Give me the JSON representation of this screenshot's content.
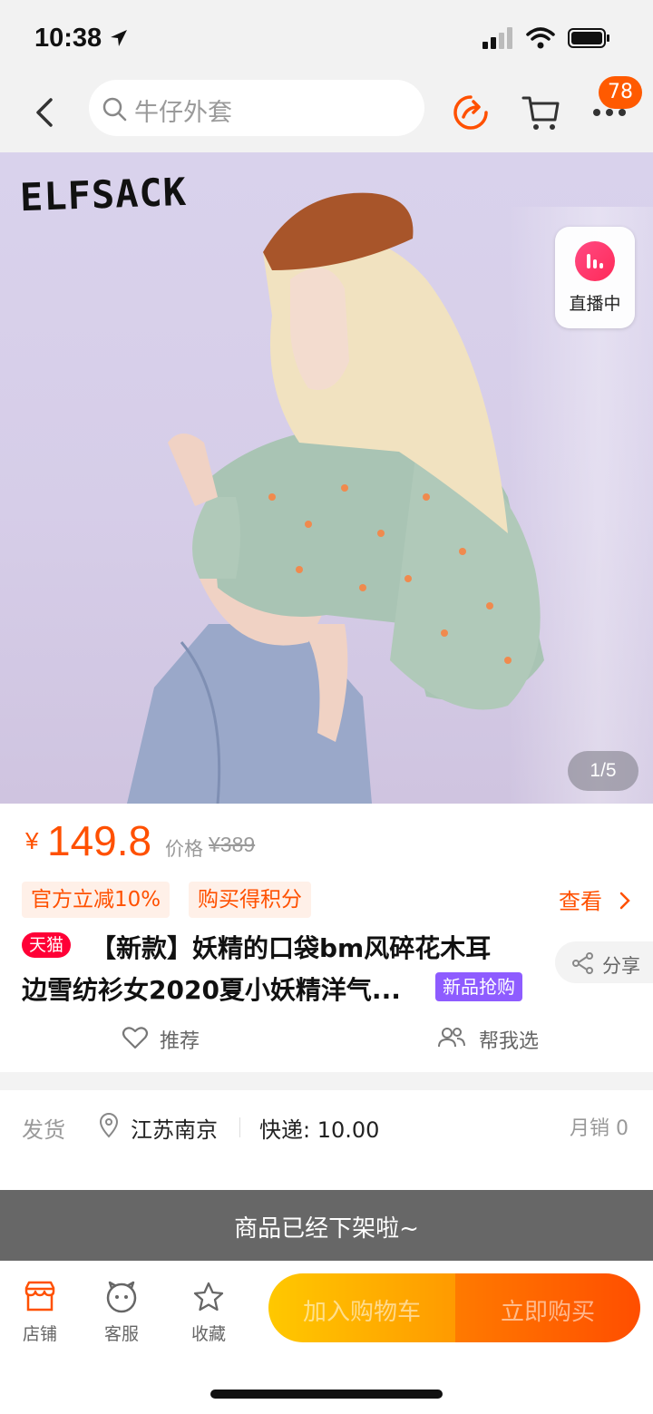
{
  "status_bar": {
    "time": "10:38"
  },
  "header": {
    "search_placeholder": "牛仔外套",
    "badge_count": "78"
  },
  "hero": {
    "brand": "ELFSACK",
    "live_label": "直播中",
    "page_indicator": "1/5"
  },
  "product": {
    "price_symbol": "¥",
    "price": "149.8",
    "orig_price_label": "价格",
    "orig_price": "¥389",
    "promo_tags": [
      "官方立减10%",
      "购买得积分"
    ],
    "check_link": "查看",
    "tmall_badge": "天猫",
    "title_line1": "【新款】妖精的口袋bm风碎花木耳",
    "title_line2": "边雪纺衫女2020夏小妖精洋气...",
    "new_tag": "新品抢购",
    "share_label": "分享",
    "recommend_label": "推荐",
    "helppick_label": "帮我选"
  },
  "delivery": {
    "label": "发货",
    "location": "江苏南京",
    "shipping": "快递: 10.00",
    "monthly_sales": "月销 0"
  },
  "toast": {
    "text": "商品已经下架啦~"
  },
  "bottom_bar": {
    "shop_label": "店铺",
    "service_label": "客服",
    "favorite_label": "收藏",
    "add_to_cart": "加入购物车",
    "buy_now": "立即购买"
  },
  "colors": {
    "accent": "#ff5000",
    "tmall_red": "#ff0036",
    "new_tag_purple": "#8e5cff"
  }
}
